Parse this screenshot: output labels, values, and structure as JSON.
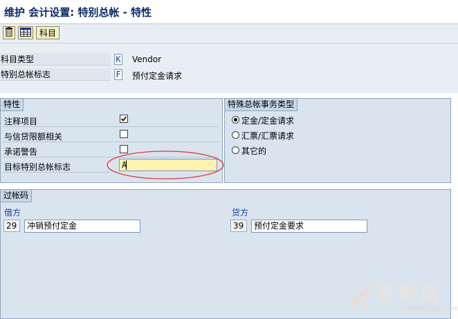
{
  "window": {
    "title": "维护 会计设置: 特别总帐 - 特性"
  },
  "toolbar": {
    "delete_icon": "trash-icon",
    "table_icon": "table-icon",
    "account_label": "科目"
  },
  "header": {
    "rows": [
      {
        "label": "科目类型",
        "key": "K",
        "value": "Vendor"
      },
      {
        "label": "特别总帐标志",
        "key": "F",
        "value": "预付定金请求"
      }
    ]
  },
  "properties": {
    "title": "特性",
    "rows": [
      {
        "label": "注释项目",
        "checked": true
      },
      {
        "label": "与信贷限额相关",
        "checked": false
      },
      {
        "label": "承诺警告",
        "checked": false
      }
    ],
    "target_label": "目标特别总帐标志",
    "target_value": "A"
  },
  "transaction_type": {
    "title": "特殊总帐事务类型",
    "options": [
      {
        "label": "定金/定金请求",
        "selected": true
      },
      {
        "label": "汇票/汇票请求",
        "selected": false
      },
      {
        "label": "其它的",
        "selected": false
      }
    ]
  },
  "posting_key": {
    "title": "过帐码",
    "debit": {
      "label": "借方",
      "code": "29",
      "description": "冲销预付定金"
    },
    "credit": {
      "label": "贷方",
      "code": "39",
      "description": "预付定金要求"
    }
  },
  "watermark": {
    "text": "赛跑网",
    "url": "www.91Sap.com"
  },
  "colors": {
    "highlight_field": "#fdf2b0",
    "annotation_ellipse": "#e23a3a",
    "group_bg": "#d9e4ef"
  }
}
